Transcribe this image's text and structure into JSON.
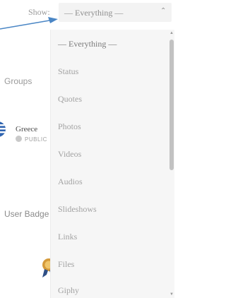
{
  "filter": {
    "label": "Show:",
    "selected": "— Everything —",
    "options": [
      "— Everything —",
      "Status",
      "Quotes",
      "Photos",
      "Videos",
      "Audios",
      "Slideshows",
      "Links",
      "Files",
      "Giphy"
    ]
  },
  "sidebar": {
    "groups_title": "Groups",
    "group": {
      "name": "Greece",
      "privacy": "PUBLIC"
    },
    "badges_title": "User Badge"
  },
  "colors": {
    "arrow": "#4a86c5",
    "dropdown_bg": "#f6f6f6",
    "trigger_bg": "#f3f3f3",
    "flag_blue": "#2f64b0"
  },
  "icons": [
    "caret-up-icon",
    "globe-icon",
    "greece-flag-icon",
    "badge-medal-icon",
    "scroll-up-icon",
    "scroll-down-icon",
    "arrow-pointer-icon"
  ]
}
